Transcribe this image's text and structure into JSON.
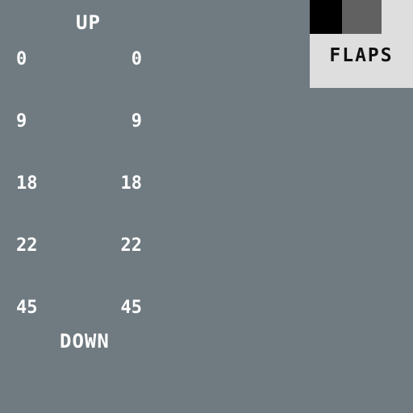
{
  "scale": {
    "title": "UP",
    "footer": "DOWN",
    "rows": [
      {
        "left": "0",
        "right": "0"
      },
      {
        "left": "9",
        "right": "9"
      },
      {
        "left": "18",
        "right": "18"
      },
      {
        "left": "22",
        "right": "22"
      },
      {
        "left": "45",
        "right": "45"
      }
    ]
  },
  "flaps_panel": {
    "label": "FLAPS",
    "swatches": [
      {
        "name": "black",
        "color": "#000000"
      },
      {
        "name": "gray",
        "color": "#616161"
      }
    ]
  },
  "colors": {
    "background": "#6f7a81",
    "panel": "#dedede",
    "text_light": "#ffffff",
    "text_dark": "#111111"
  }
}
